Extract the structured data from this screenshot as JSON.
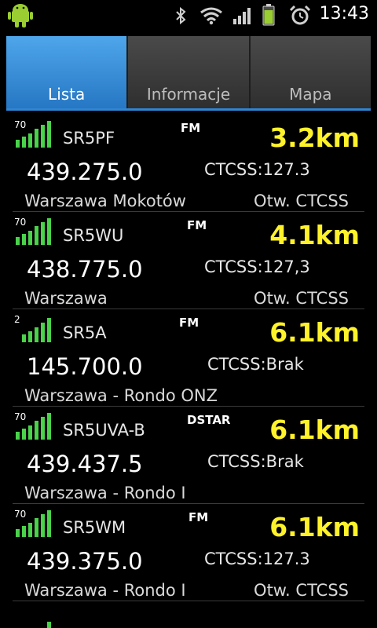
{
  "status": {
    "time": "13:43",
    "icons": [
      "android-icon",
      "bluetooth-icon",
      "wifi-icon",
      "cell-signal-icon",
      "battery-icon",
      "alarm-icon"
    ]
  },
  "tabs": [
    {
      "label": "Lista",
      "active": true
    },
    {
      "label": "Informacje",
      "active": false
    },
    {
      "label": "Mapa",
      "active": false
    }
  ],
  "colors": {
    "accent": "#2f86d2",
    "distance": "#fff22a",
    "signal": "#49d24a"
  },
  "repeaters": [
    {
      "signal": "70",
      "callsign": "SR5PF",
      "mode": "FM",
      "distance": "3.2km",
      "frequency": "439.275.0",
      "ctcss": "CTCSS:127.3",
      "location": "Warszawa Mokotów",
      "access": "Otw. CTCSS"
    },
    {
      "signal": "70",
      "callsign": "SR5WU",
      "mode": "FM",
      "distance": "4.1km",
      "frequency": "438.775.0",
      "ctcss": "CTCSS:127,3",
      "location": "Warszawa",
      "access": "Otw. CTCSS"
    },
    {
      "signal": "2",
      "callsign": "SR5A",
      "mode": "FM",
      "distance": "6.1km",
      "frequency": "145.700.0",
      "ctcss": "CTCSS:Brak",
      "location": "Warszawa - Rondo ONZ",
      "access": ""
    },
    {
      "signal": "70",
      "callsign": "SR5UVA-B",
      "mode": "DSTAR",
      "distance": "6.1km",
      "frequency": "439.437.5",
      "ctcss": "CTCSS:Brak",
      "location": "Warszawa - Rondo I",
      "access": ""
    },
    {
      "signal": "70",
      "callsign": "SR5WM",
      "mode": "FM",
      "distance": "6.1km",
      "frequency": "439.375.0",
      "ctcss": "CTCSS:127.3",
      "location": "Warszawa - Rondo I",
      "access": "Otw. CTCSS"
    }
  ]
}
